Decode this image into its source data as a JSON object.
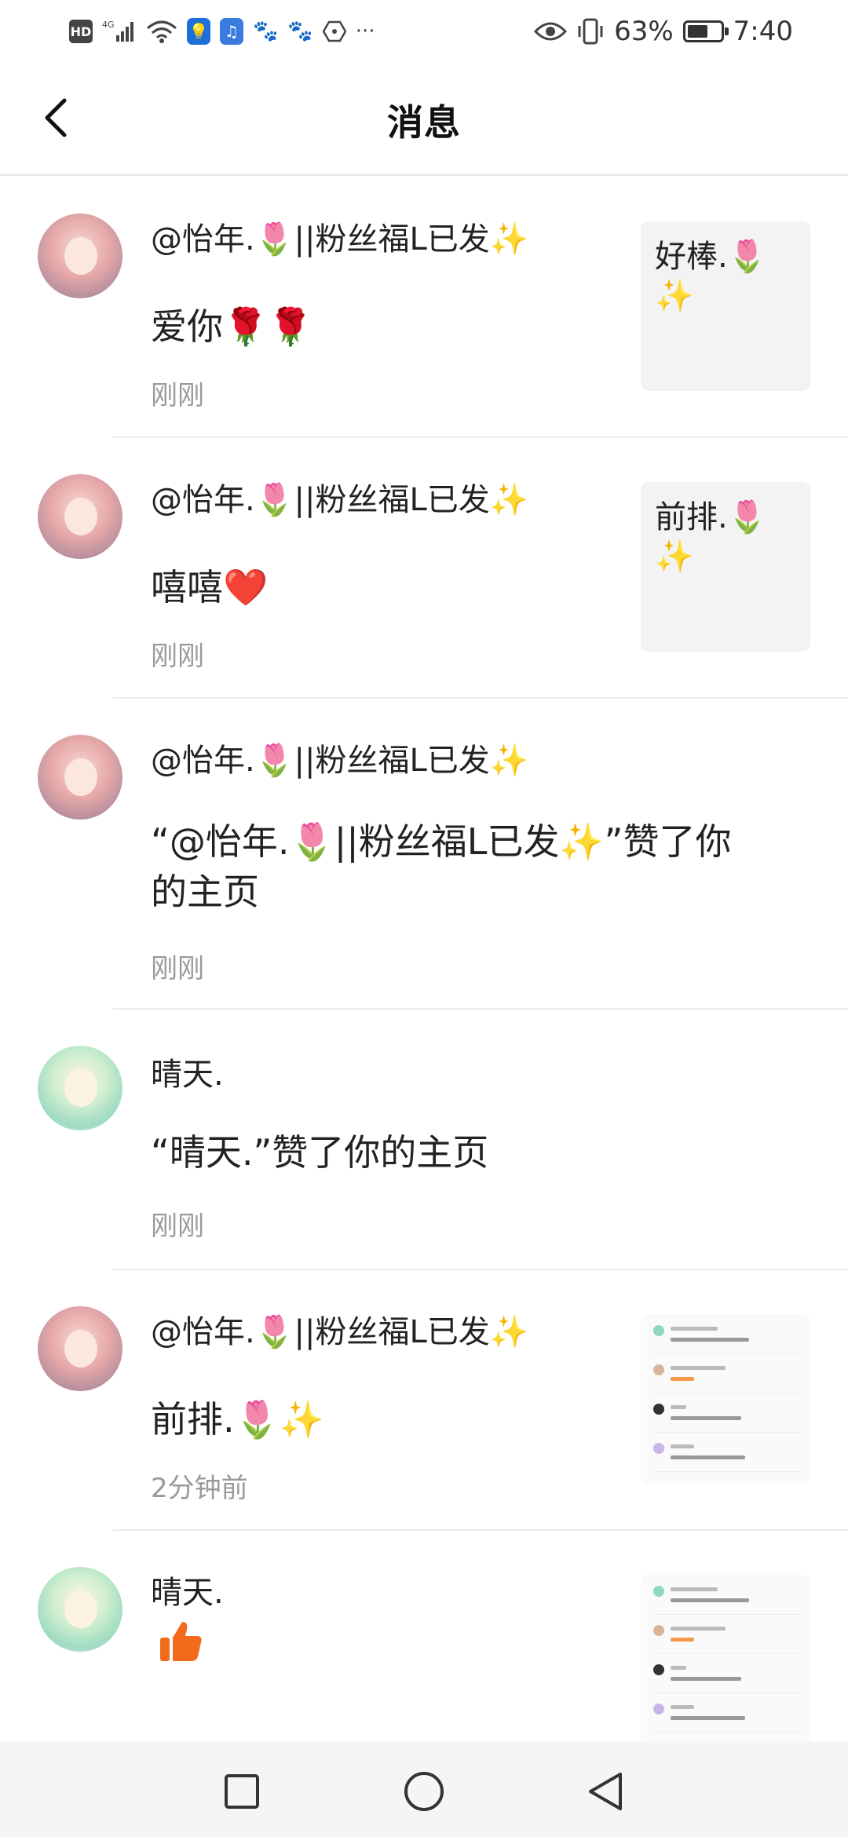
{
  "status_bar": {
    "left_icons": [
      "hd-badge",
      "4g-signal-icon",
      "wifi-icon",
      "lightbulb-app-icon",
      "music-app-icon",
      "baidu-icon",
      "baidu-icon",
      "hexagon-app-icon",
      "more-dots-icon"
    ],
    "hd_label": "HD",
    "network_label": "4G",
    "battery_percent": "63%",
    "battery_level": 0.63,
    "time": "7:40"
  },
  "header": {
    "back_icon": "chevron-left-icon",
    "title": "消息"
  },
  "messages": [
    {
      "sender": "@怡年.🌷||粉丝福L已发✨",
      "text": "爱你🌹🌹",
      "time": "刚刚",
      "avatar": "pink",
      "thumb_text": "好棒.🌷✨"
    },
    {
      "sender": "@怡年.🌷||粉丝福L已发✨",
      "text": "嘻嘻❤️",
      "time": "刚刚",
      "avatar": "pink",
      "thumb_text": "前排.🌷✨"
    },
    {
      "sender": "@怡年.🌷||粉丝福L已发✨",
      "text_line1": "“@怡年.🌷||粉丝福L已发✨”赞了你",
      "text_line2": "的主页",
      "time": "刚刚",
      "avatar": "pink"
    },
    {
      "sender": "晴天.",
      "text": "“晴天.”赞了你的主页",
      "time": "刚刚",
      "avatar": "green"
    },
    {
      "sender": "@怡年.🌷||粉丝福L已发✨",
      "text": "前排.🌷✨",
      "time": "2分钟前",
      "avatar": "pink",
      "thumb": "screenshot-preview"
    },
    {
      "sender": "晴天.",
      "avatar": "green",
      "reaction_icon": "thumbs-up-icon",
      "thumb": "screenshot-preview"
    }
  ],
  "nav_bar": {
    "icons": [
      "square-recents-icon",
      "circle-home-icon",
      "triangle-back-icon"
    ]
  },
  "colors": {
    "background": "#ffffff",
    "divider": "#ececec",
    "time_text": "#9a9a9a",
    "like_orange": "#f26a1b",
    "navbar": "#f5f5f5"
  }
}
